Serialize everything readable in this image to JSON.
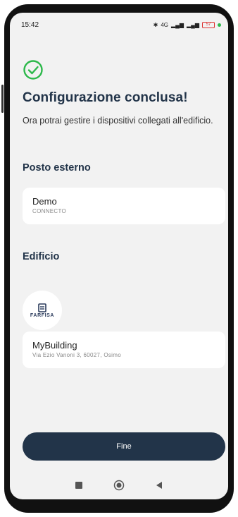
{
  "status_bar": {
    "time": "15:42",
    "network_label": "4G",
    "battery": "57"
  },
  "header": {
    "title": "Configurazione conclusa!",
    "subtitle": "Ora potrai gestire i dispositivi collegati all'edificio."
  },
  "outdoor_station": {
    "section_title": "Posto esterno",
    "name": "Demo",
    "type": "CONNECTO"
  },
  "building": {
    "section_title": "Edificio",
    "logo_text": "FARFISA",
    "name": "MyBuilding",
    "address": "Via Ezio Vanoni 3, 60027, Osimo"
  },
  "actions": {
    "finish_label": "Fine"
  },
  "colors": {
    "accent": "#223449",
    "success": "#2cb84a",
    "background": "#f2f2f2",
    "card": "#ffffff"
  }
}
